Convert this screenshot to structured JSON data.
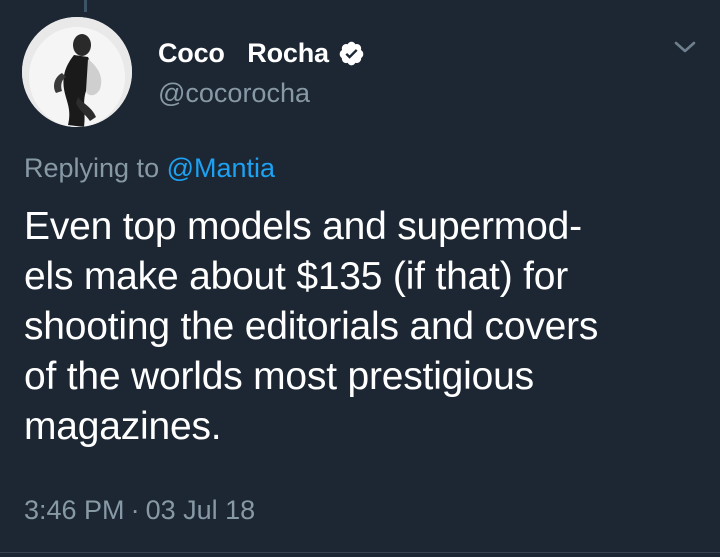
{
  "author": {
    "display_name": "Coco  Rocha",
    "handle": "@cocorocha",
    "verified": true,
    "avatar_icon": "profile-photo"
  },
  "reply": {
    "prefix": "Replying to",
    "mention": "@Mantia"
  },
  "tweet": {
    "lines": [
      "Even top models and supermod-",
      "els make about $135 (if that) for",
      "shooting the editorials and covers",
      "of the worlds most prestigious",
      "magazines."
    ],
    "time": "3:46 PM",
    "separator": "·",
    "date": "03 Jul 18"
  },
  "icons": {
    "verified": "verified-badge-icon",
    "menu": "chevron-down-icon"
  },
  "colors": {
    "background": "#1c2733",
    "text": "#ffffff",
    "secondary_text": "#8899a6",
    "link": "#1da1f2"
  }
}
